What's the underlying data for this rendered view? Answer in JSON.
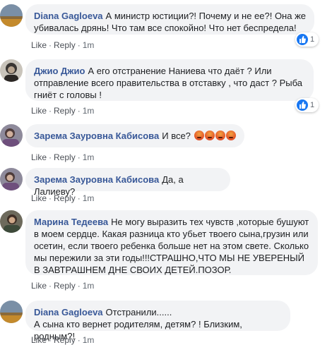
{
  "comments": [
    {
      "author": "Diana Gagloeva",
      "text": "А министр юстиции?! Почему и не ее?! Она же убивалась дрянь! Что там все спокойно! Что нет беспредела!",
      "like": "Like",
      "reply": "Reply",
      "time": "1m",
      "reaction_count": "1"
    },
    {
      "author": "Джио Джио",
      "text": "А его отстранение Наниева что даёт ? Или отправление всего правительства в отставку , что даст ? Рыба гниёт с головы !",
      "like": "Like",
      "reply": "Reply",
      "time": "1m",
      "reaction_count": "1"
    },
    {
      "author": "Зарема Зауровна Кабисова",
      "text": "И все?",
      "like": "Like",
      "reply": "Reply",
      "time": "1m"
    },
    {
      "author": "Зарема Зауровна Кабисова",
      "text": "Да, а Лалиеву?",
      "like": "Like",
      "reply": "Reply",
      "time": "1m"
    },
    {
      "author": "Марина Тедеева",
      "text": "Не могу выразить тех чувств ,которые бушуют в моем сердце. Какая разница кто убьет твоего сына,грузин или осетин, если твоего ребенка больше нет на этом свете. Сколько мы пережили за эти годы!!!СТРАШНО,ЧТО МЫ НЕ УВЕРЕНЫЙ В ЗАВТРАШНЕМ ДНЕ СВОИХ ДЕТЕЙ.ПОЗОР.",
      "like": "Like",
      "reply": "Reply",
      "time": "1m"
    },
    {
      "author": "Diana Gagloeva",
      "text_line1": "Отстранили......",
      "text_line2": "А сына кто вернет родителям, детям? ! Близким, родным?!",
      "like": "Like",
      "reply": "Reply",
      "time": "1m"
    }
  ],
  "colors": {
    "name": "#385898",
    "bubble": "#f2f3f5",
    "like_blue": "#1877f2"
  },
  "icons": [
    "like-icon",
    "angry-emoji-icon"
  ]
}
